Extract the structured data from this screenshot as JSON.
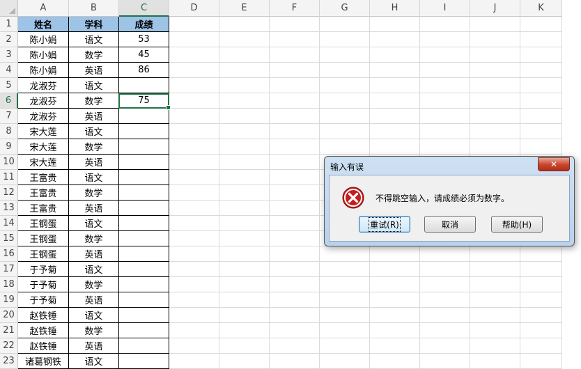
{
  "columns": [
    "A",
    "B",
    "C",
    "D",
    "E",
    "F",
    "G",
    "H",
    "I",
    "J",
    "K"
  ],
  "active_column": "C",
  "active_row": 6,
  "header_row": [
    "姓名",
    "学科",
    "成绩"
  ],
  "rows": [
    [
      "陈小娟",
      "语文",
      "53"
    ],
    [
      "陈小娟",
      "数学",
      "45"
    ],
    [
      "陈小娟",
      "英语",
      "86"
    ],
    [
      "龙淑芬",
      "语文",
      ""
    ],
    [
      "龙淑芬",
      "数学",
      "75"
    ],
    [
      "龙淑芬",
      "英语",
      ""
    ],
    [
      "宋大莲",
      "语文",
      ""
    ],
    [
      "宋大莲",
      "数学",
      ""
    ],
    [
      "宋大莲",
      "英语",
      ""
    ],
    [
      "王富贵",
      "语文",
      ""
    ],
    [
      "王富贵",
      "数学",
      ""
    ],
    [
      "王富贵",
      "英语",
      ""
    ],
    [
      "王钢蛋",
      "语文",
      ""
    ],
    [
      "王钢蛋",
      "数学",
      ""
    ],
    [
      "王钢蛋",
      "英语",
      ""
    ],
    [
      "于予菊",
      "语文",
      ""
    ],
    [
      "于予菊",
      "数学",
      ""
    ],
    [
      "于予菊",
      "英语",
      ""
    ],
    [
      "赵铁锤",
      "语文",
      ""
    ],
    [
      "赵铁锤",
      "数学",
      ""
    ],
    [
      "赵铁锤",
      "英语",
      ""
    ],
    [
      "诸葛钢铁",
      "语文",
      ""
    ]
  ],
  "colors": {
    "header_fill": "#9dc3e6",
    "accent": "#217346"
  },
  "dialog": {
    "title": "输入有误",
    "close_label": "✕",
    "icon": "error-icon",
    "message": "不得跳空输入，请成绩必须为数字。",
    "retry_label": "重试(R)",
    "cancel_label": "取消",
    "help_label": "帮助(H)"
  }
}
